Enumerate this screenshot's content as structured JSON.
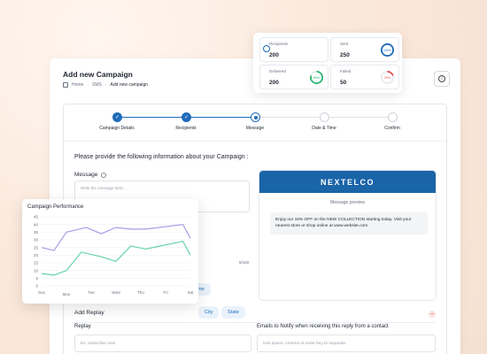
{
  "page": {
    "title": "Add new Campaign",
    "breadcrumb": [
      "Home",
      "SMS",
      "Add new campaign"
    ]
  },
  "stepper": {
    "steps": [
      {
        "label": "Campaign Details",
        "state": "done"
      },
      {
        "label": "Recipients",
        "state": "done"
      },
      {
        "label": "Message",
        "state": "active"
      },
      {
        "label": "Date & Time",
        "state": "todo"
      },
      {
        "label": "Confirm",
        "state": "todo"
      }
    ],
    "accent": "#1e6bb8"
  },
  "form": {
    "heading": "Please provide the following information about your Campaign :",
    "message_label": "Message",
    "message_placeholder": "Write the message here..",
    "char_count": "8/160",
    "chips": [
      "ame",
      "City",
      "State"
    ]
  },
  "preview": {
    "brand": "NEXTELCO",
    "title": "Message preview",
    "text": "Enjoy our 15% OFF on the NEW COLLECTION starting today. Visit your nearest store or shop online at www.website.com"
  },
  "replay": {
    "section_title": "Add Replay",
    "replay_label": "Replay",
    "replay_placeholder": "Ex: subscribe now",
    "emails_label": "Emails to Notify when receiving this reply from a contact",
    "emails_placeholder": "Use space, comma or enter key to separate."
  },
  "stats": {
    "recipients": {
      "label": "Recipients",
      "value": "200"
    },
    "sent": {
      "label": "Sent",
      "value": "250",
      "percent": 100,
      "color": "#1e6bb8"
    },
    "delivered": {
      "label": "Delivered",
      "value": "200",
      "percent": 80,
      "color": "#2bb673"
    },
    "failed": {
      "label": "Failed",
      "value": "50",
      "percent": 20,
      "color": "#e0524f"
    }
  },
  "chart_data": {
    "type": "line",
    "title": "Campaign Performance",
    "categories": [
      "Sun",
      "Mon",
      "Tue",
      "Wed",
      "Thu",
      "Fri",
      "Sat"
    ],
    "yticks": [
      0,
      5,
      10,
      15,
      20,
      25,
      30,
      35,
      40,
      45
    ],
    "ylim": [
      0,
      45
    ],
    "series": [
      {
        "values": [
          25,
          23,
          35,
          38,
          34,
          38,
          37,
          37,
          40,
          31
        ],
        "x": [
          0,
          0.5,
          1,
          1.8,
          2.4,
          3,
          3.6,
          4.2,
          5.7,
          6
        ],
        "color": "#a99be8"
      },
      {
        "values": [
          8,
          7,
          10,
          22,
          19,
          16,
          26,
          24,
          29,
          20
        ],
        "x": [
          0,
          0.5,
          1,
          1.6,
          2.4,
          3,
          3.6,
          4.2,
          5.7,
          6
        ],
        "color": "#66d4a6"
      }
    ]
  }
}
